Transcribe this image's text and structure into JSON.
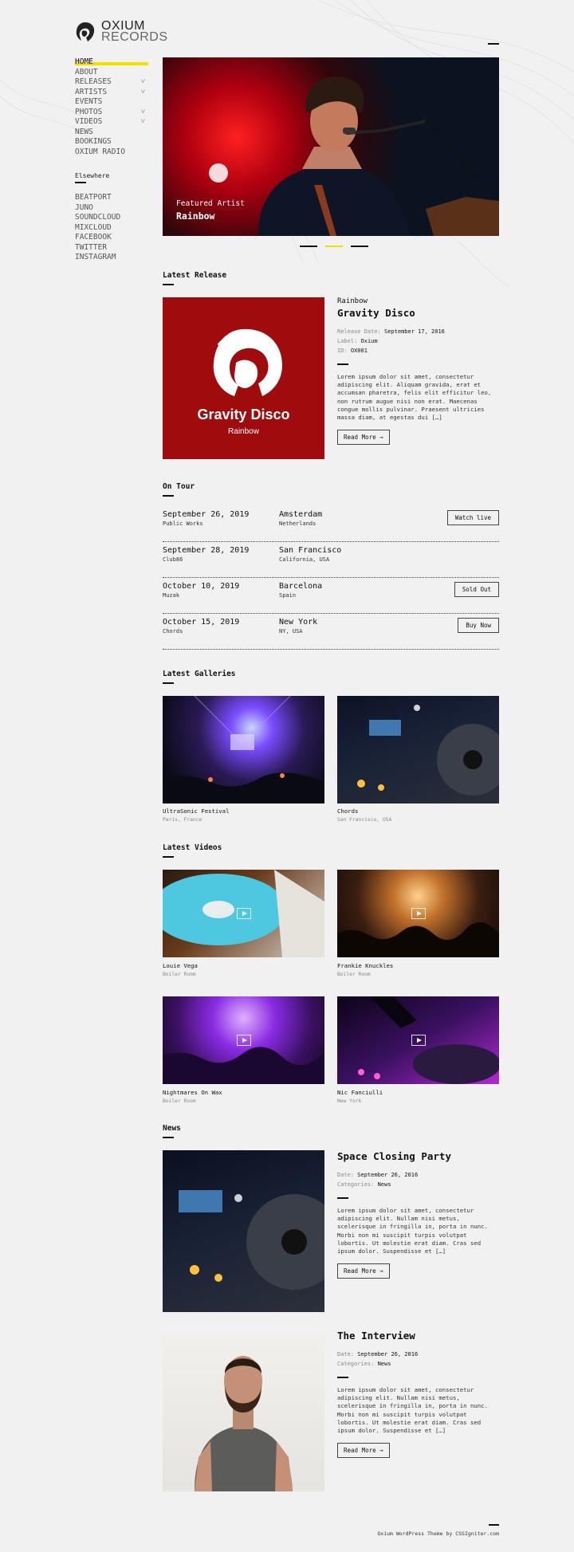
{
  "logo": {
    "line1": "OXIUM",
    "line2": "RECORDS"
  },
  "nav": [
    {
      "label": "HOME",
      "caret": ""
    },
    {
      "label": "ABOUT",
      "caret": ""
    },
    {
      "label": "RELEASES",
      "caret": "˅"
    },
    {
      "label": "ARTISTS",
      "caret": "˅"
    },
    {
      "label": "EVENTS",
      "caret": ""
    },
    {
      "label": "PHOTOS",
      "caret": "˅"
    },
    {
      "label": "VIDEOS",
      "caret": "˅"
    },
    {
      "label": "NEWS",
      "caret": ""
    },
    {
      "label": "BOOKINGS",
      "caret": ""
    },
    {
      "label": "OXIUM RADIO",
      "caret": ""
    }
  ],
  "elsewhere": {
    "title": "Elsewhere",
    "links": [
      "BEATPORT",
      "JUNO",
      "SOUNDCLOUD",
      "MIXCLOUD",
      "FACEBOOK",
      "TWITTER",
      "INSTAGRAM"
    ]
  },
  "hero": {
    "caption_small": "Featured Artist",
    "caption_big": "Rainbow"
  },
  "latest_release": {
    "heading": "Latest Release",
    "cover_title": "Gravity Disco",
    "cover_sub": "Rainbow",
    "artist": "Rainbow",
    "title": "Gravity Disco",
    "release_date_label": "Release Date:",
    "release_date": "September 17, 2016",
    "label_label": "Label:",
    "label": "Oxium",
    "id_label": "ID:",
    "id": "OX001",
    "text": "Lorem ipsum dolor sit amet, consectetur adipiscing elit. Aliquam gravida, erat et accumsan pharetra, felis elit efficitur leo, non rutrum augue nisi non erat. Maecenas congue mollis pulvinar. Praesent ultricies massa diam, at egestas dui […]",
    "button": "Read More →"
  },
  "tour": {
    "heading": "On Tour",
    "events": [
      {
        "date": "September 26, 2019",
        "venue": "Public Works",
        "city": "Amsterdam",
        "country": "Netherlands",
        "button": "Watch live"
      },
      {
        "date": "September 28, 2019",
        "venue": "Club86",
        "city": "San Francisco",
        "country": "California, USA",
        "button": ""
      },
      {
        "date": "October 10, 2019",
        "venue": "Muzak",
        "city": "Barcelona",
        "country": "Spain",
        "button": "Sold Out"
      },
      {
        "date": "October 15, 2019",
        "venue": "Chords",
        "city": "New York",
        "country": "NY, USA",
        "button": "Buy Now"
      }
    ]
  },
  "galleries": {
    "heading": "Latest Galleries",
    "items": [
      {
        "title": "UltraSonic Festival",
        "sub": "Paris, France"
      },
      {
        "title": "Chords",
        "sub": "San Francisco, USA"
      }
    ]
  },
  "videos": {
    "heading": "Latest Videos",
    "items": [
      {
        "title": "Louie Vega",
        "sub": "Boiler Room"
      },
      {
        "title": "Frankie Knuckles",
        "sub": "Boiler Room"
      },
      {
        "title": "Nightmares On Wax",
        "sub": "Boiler Room"
      },
      {
        "title": "Nic Fanciulli",
        "sub": "New York"
      }
    ]
  },
  "news": {
    "heading": "News",
    "items": [
      {
        "title": "Space Closing Party",
        "date_label": "Date:",
        "date": "September 26, 2016",
        "cat_label": "Categories:",
        "cat": "News",
        "text": "Lorem ipsum dolor sit amet, consectetur adipiscing elit. Nullam nisi metus, scelerisque in fringilla in, porta in nunc. Morbi non mi suscipit turpis volutpat lobortis. Ut molestie erat diam. Cras sed ipsum dolor. Suspendisse et […]",
        "button": "Read More →"
      },
      {
        "title": "The Interview",
        "date_label": "Date:",
        "date": "September 26, 2016",
        "cat_label": "Categories:",
        "cat": "News",
        "text": "Lorem ipsum dolor sit amet, consectetur adipiscing elit. Nullam nisi metus, scelerisque in fringilla in, porta in nunc. Morbi non mi suscipit turpis volutpat lobortis. Ut molestie erat diam. Cras sed ipsum dolor. Suspendisse et […]",
        "button": "Read More →"
      }
    ]
  },
  "footer": {
    "text": "Oxium WordPress Theme by CSSIgniter.com"
  },
  "colors": {
    "accent": "#f0e000",
    "cover": "#a00b0e"
  }
}
